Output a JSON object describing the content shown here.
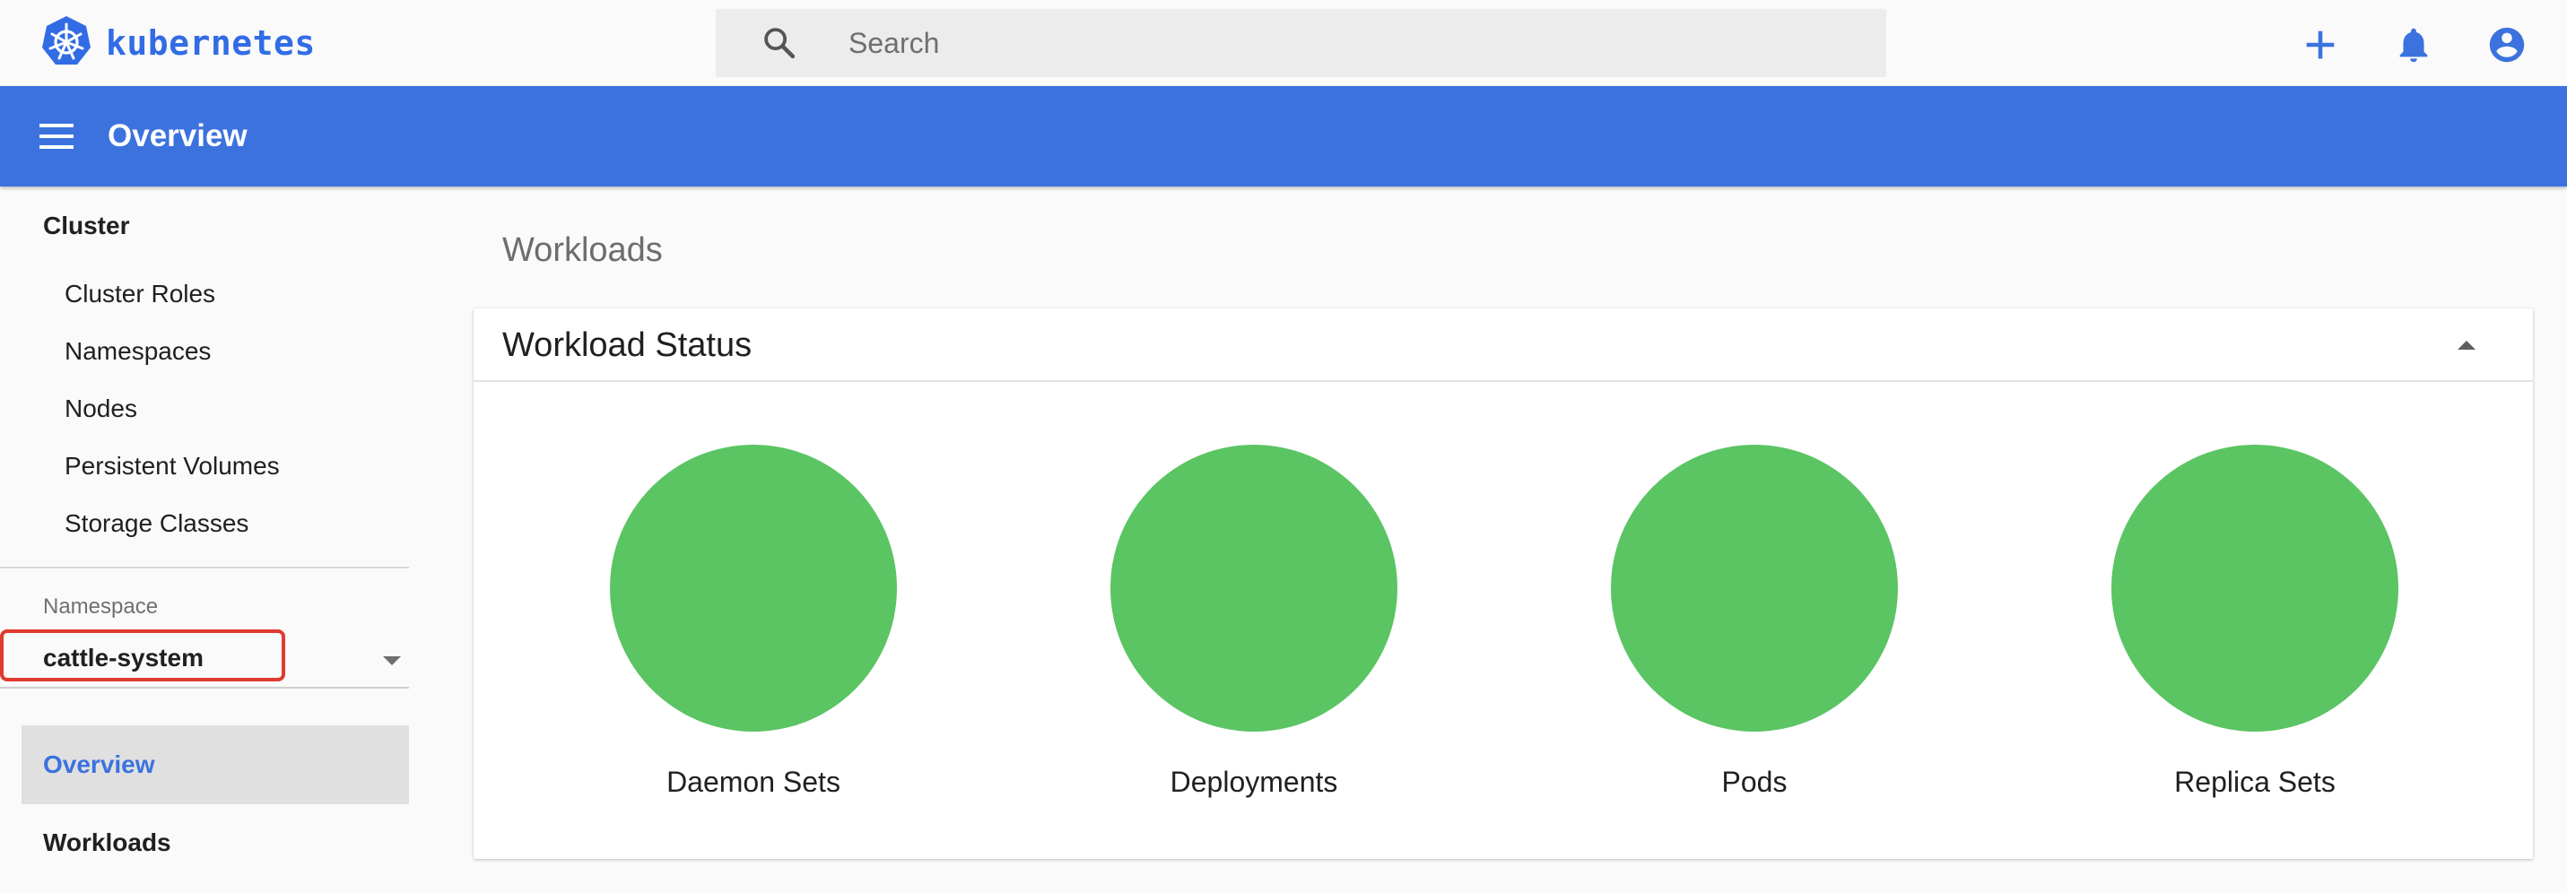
{
  "brand": {
    "name": "kubernetes",
    "logo_icon": "kubernetes-helm-wheel-icon",
    "color": "#326ce5"
  },
  "search": {
    "placeholder": "Search",
    "icon": "search-icon"
  },
  "top_actions": [
    {
      "name": "create-button",
      "icon": "plus-icon"
    },
    {
      "name": "notifications-button",
      "icon": "bell-icon"
    },
    {
      "name": "account-button",
      "icon": "account-circle-icon"
    }
  ],
  "titlebar": {
    "title": "Overview",
    "menu_icon": "hamburger-menu-icon",
    "color": "#3b72de"
  },
  "sidebar": {
    "cluster_heading": "Cluster",
    "cluster_items": [
      {
        "label": "Cluster Roles"
      },
      {
        "label": "Namespaces"
      },
      {
        "label": "Nodes"
      },
      {
        "label": "Persistent Volumes"
      },
      {
        "label": "Storage Classes"
      }
    ],
    "namespace_label": "Namespace",
    "namespace_value": "cattle-system",
    "nav": [
      {
        "label": "Overview",
        "active": true
      },
      {
        "label": "Workloads",
        "active": false
      }
    ]
  },
  "main": {
    "section_title": "Workloads",
    "card": {
      "title": "Workload Status",
      "collapse_icon": "collapse-arrow-up-icon",
      "status_color": "#5bc463",
      "statuses": [
        {
          "label": "Daemon Sets"
        },
        {
          "label": "Deployments"
        },
        {
          "label": "Pods"
        },
        {
          "label": "Replica Sets"
        }
      ]
    }
  }
}
